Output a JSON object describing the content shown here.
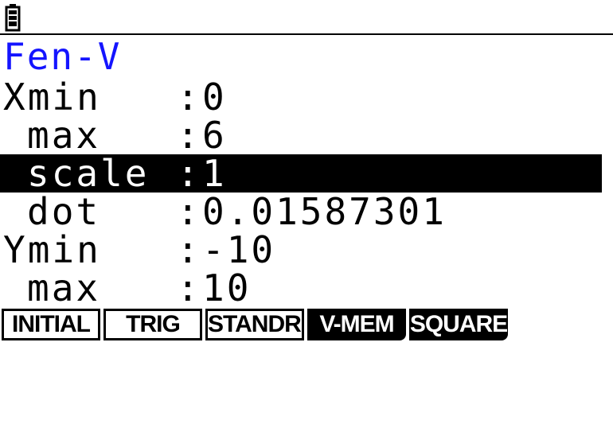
{
  "status_bar": {
    "battery_icon": "battery-icon"
  },
  "title": "Fen-V",
  "rows": [
    {
      "label": "Xmin",
      "colon": ":",
      "value": "0"
    },
    {
      "label": "max",
      "colon": ":",
      "value": "6"
    },
    {
      "label": "scale",
      "colon": ":",
      "value": "1"
    },
    {
      "label": "dot",
      "colon": ":",
      "value": "0.01587301"
    },
    {
      "label": "Ymin",
      "colon": ":",
      "value": "-10"
    },
    {
      "label": "max",
      "colon": ":",
      "value": "10"
    }
  ],
  "selected_row": "scale",
  "function_keys": [
    {
      "label": "INITIAL"
    },
    {
      "label": "TRIG"
    },
    {
      "label": "STANDRD"
    },
    {
      "label": "V-MEM"
    },
    {
      "label": "SQUARE"
    }
  ],
  "colors": {
    "title": "#1414ff",
    "text": "#000000",
    "background": "#ffffff",
    "highlight": "#000000"
  }
}
